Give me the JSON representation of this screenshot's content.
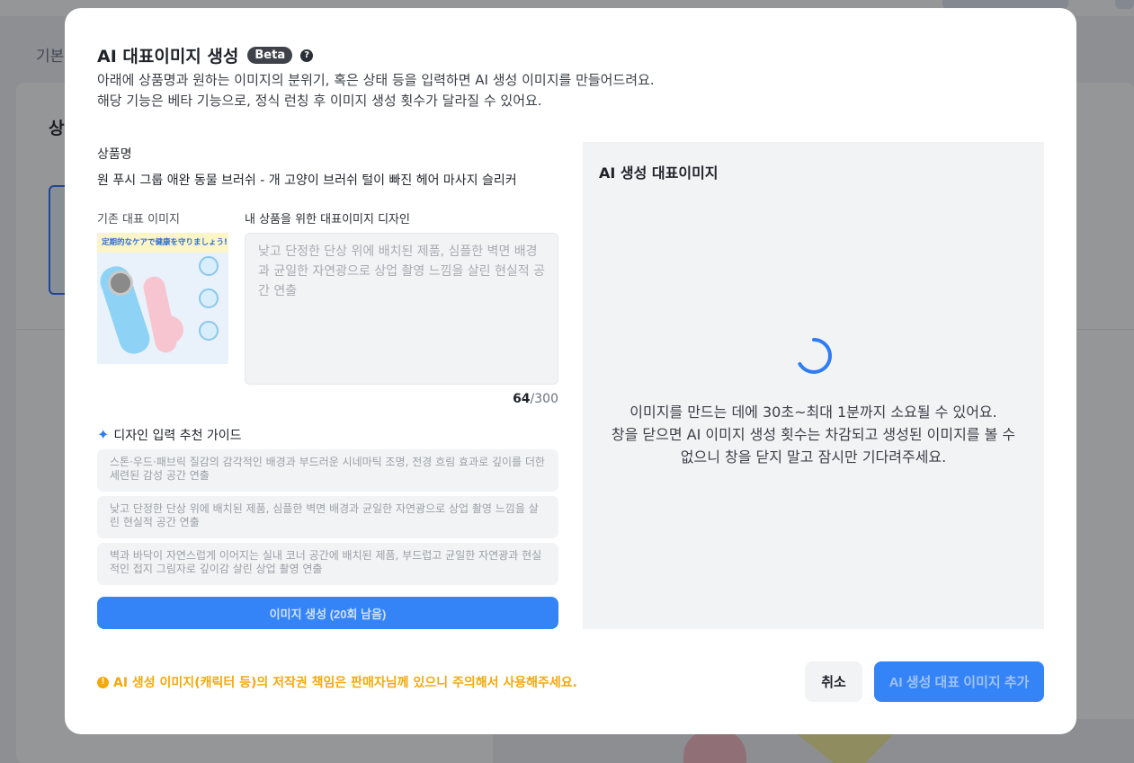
{
  "background": {
    "tab_label": "기본",
    "heading": "상"
  },
  "modal": {
    "title": "AI 대표이미지 생성",
    "badge": "Beta",
    "help_symbol": "?",
    "description_line1": "아래에 상품명과 원하는 이미지의 분위기, 혹은 상태 등을 입력하면 AI 생성 이미지를 만들어드려요.",
    "description_line2": "해당 기능은 베타 기능으로, 정식 런칭 후 이미지 생성 횟수가 달라질 수 있어요."
  },
  "product": {
    "label": "상품명",
    "name": "원 푸시 그룹 애완 동물 브러쉬 - 개 고양이 브러쉬 털이 빠진 헤어 마사지 슬리커 ..."
  },
  "existing_image": {
    "label": "기존 대표 이미지",
    "banner_text": "定期的なケアで健康を守りましょう!"
  },
  "design": {
    "label": "내 상품을 위한 대표이미지 디자인",
    "placeholder": "낮고 단정한 단상 위에 배치된 제품, 심플한 벽면 배경과 균일한 자연광으로 상업 촬영 느낌을 살린 현실적 공간 연출",
    "count": "64",
    "max": "/300"
  },
  "guide": {
    "title": "디자인 입력 추천 가이드",
    "icon": "sparkle-icon",
    "items": [
      "스톤·우드·패브릭 질감의 감각적인 배경과 부드러운 시네마틱 조명, 전경 흐림 효과로 깊이를 더한 세련된 감성 공간 연출",
      "낮고 단정한 단상 위에 배치된 제품, 심플한 벽면 배경과 균일한 자연광으로 상업 촬영 느낌을 살린 현실적 공간 연출",
      "벽과 바닥이 자연스럽게 이어지는 실내 코너 공간에 배치된 제품, 부드럽고 균일한 자연광과 현실적인 접지 그림자로 깊이감 살린 상업 촬영 연출"
    ]
  },
  "generate_button": "이미지 생성 (20회 남음)",
  "ai_panel": {
    "title": "AI 생성 대표이미지",
    "loading_line1": "이미지를 만드는 데에 30초~최대 1분까지 소요될 수 있어요.",
    "loading_line2": "창을 닫으면 AI 이미지 생성 횟수는 차감되고 생성된 이미지를 볼 수",
    "loading_line3": "없으니 창을 닫지 말고 잠시만 기다려주세요."
  },
  "footer": {
    "warning_symbol": "!",
    "warning": "AI 생성 이미지(캐릭터 등)의 저작권 책임은 판매자님께 있으니 주의해서 사용해주세요.",
    "cancel": "취소",
    "add": "AI 생성 대표 이미지 추가"
  },
  "colors": {
    "primary": "#3584f7",
    "warning": "#f4a90b",
    "panel_bg": "#f2f3f5"
  }
}
